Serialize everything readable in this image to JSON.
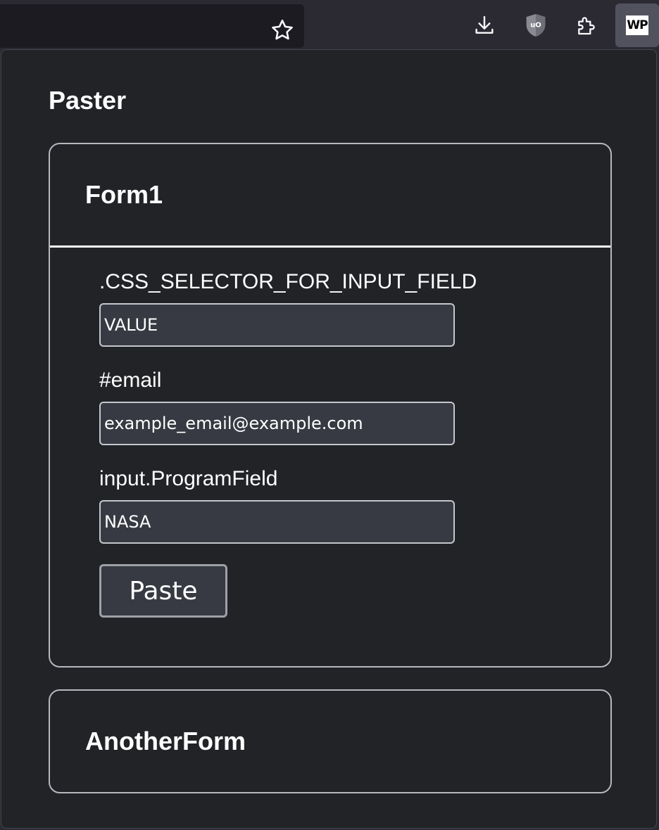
{
  "browser": {
    "icons": [
      "star-icon",
      "download-icon",
      "ublock-icon",
      "extensions-icon",
      "wp-extension-icon"
    ],
    "wp_icon_text": "WP"
  },
  "app": {
    "title": "Paster"
  },
  "forms": [
    {
      "name": "Form1",
      "fields": [
        {
          "label": ".CSS_SELECTOR_FOR_INPUT_FIELD",
          "value": "VALUE"
        },
        {
          "label": "#email",
          "value": "example_email@example.com"
        },
        {
          "label": "input.ProgramField",
          "value": "NASA"
        }
      ],
      "paste_label": "Paste"
    },
    {
      "name": "AnotherForm"
    }
  ],
  "colors": {
    "panel_background": "#212327",
    "input_background": "#373a42",
    "border": "#b5b8bd",
    "text": "#ffffff"
  }
}
